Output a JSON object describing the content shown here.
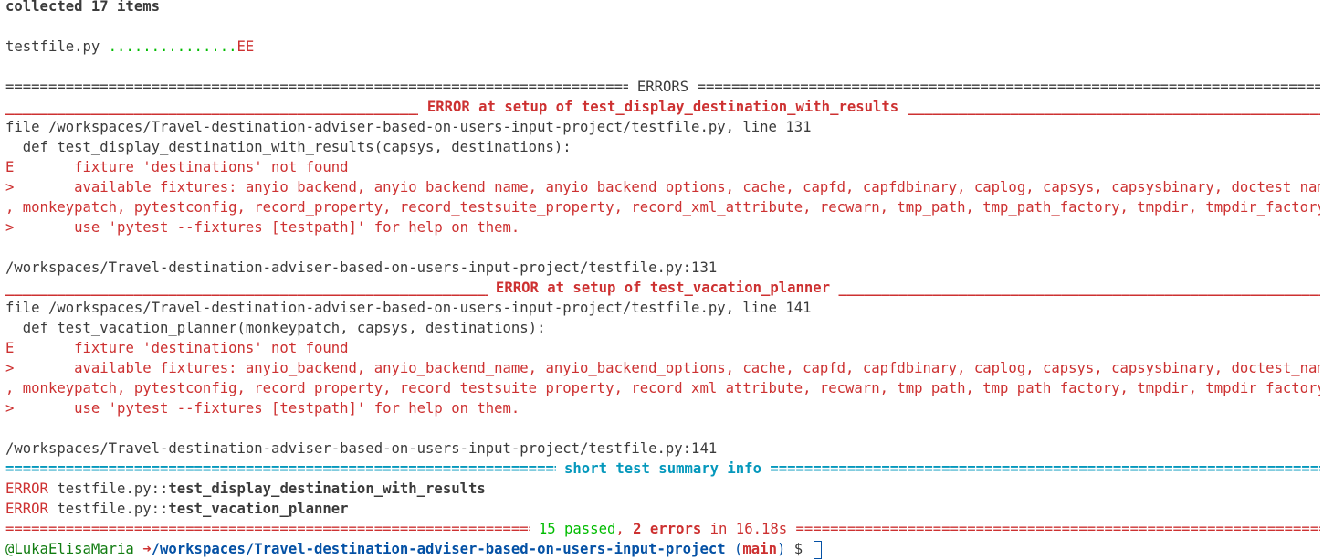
{
  "colors": {
    "background": "#ffffff",
    "text": "#3b3b3b",
    "error_red": "#cd3131",
    "pass_green": "#00bc00",
    "summary_cyan": "#0598bc",
    "prompt_blue": "#0451a5"
  },
  "header": {
    "collected": "collected 17 items"
  },
  "progress": {
    "file": "testfile.py ",
    "dots": "...............",
    "errs": "EE"
  },
  "errors_header": " ERRORS ",
  "errors": [
    {
      "title": " ERROR at setup of test_display_destination_with_results ",
      "file_line": "file /workspaces/Travel-destination-adviser-based-on-users-input-project/testfile.py, line 131",
      "def_line": "  def test_display_destination_with_results(capsys, destinations):",
      "e_prefix": "E       ",
      "e_text": "fixture 'destinations' not found",
      "avail_prefix": ">       ",
      "avail_text": "available fixtures: anyio_backend, anyio_backend_name, anyio_backend_options, cache, capfd, capfdbinary, caplog, capsys, capsysbinary, doctest_namespace",
      "avail_cont": ", monkeypatch, pytestconfig, record_property, record_testsuite_property, record_xml_attribute, recwarn, tmp_path, tmp_path_factory, tmpdir, tmpdir_factory",
      "use_prefix": ">       ",
      "use_text": "use 'pytest --fixtures [testpath]' for help on them.",
      "location": "/workspaces/Travel-destination-adviser-based-on-users-input-project/testfile.py:131"
    },
    {
      "title": " ERROR at setup of test_vacation_planner ",
      "file_line": "file /workspaces/Travel-destination-adviser-based-on-users-input-project/testfile.py, line 141",
      "def_line": "  def test_vacation_planner(monkeypatch, capsys, destinations):",
      "e_prefix": "E       ",
      "e_text": "fixture 'destinations' not found",
      "avail_prefix": ">       ",
      "avail_text": "available fixtures: anyio_backend, anyio_backend_name, anyio_backend_options, cache, capfd, capfdbinary, caplog, capsys, capsysbinary, doctest_namespace",
      "avail_cont": ", monkeypatch, pytestconfig, record_property, record_testsuite_property, record_xml_attribute, recwarn, tmp_path, tmp_path_factory, tmpdir, tmpdir_factory",
      "use_prefix": ">       ",
      "use_text": "use 'pytest --fixtures [testpath]' for help on them.",
      "location": "/workspaces/Travel-destination-adviser-based-on-users-input-project/testfile.py:141"
    }
  ],
  "summary": {
    "title": " short test summary info ",
    "items": [
      {
        "kind": "ERROR",
        "file": " testfile.py::",
        "test": "test_display_destination_with_results"
      },
      {
        "kind": "ERROR",
        "file": " testfile.py::",
        "test": "test_vacation_planner"
      }
    ]
  },
  "result": {
    "passed": " 15 passed",
    "comma": ", ",
    "errors": "2 errors",
    "time": " in 16.18s "
  },
  "prompt": {
    "user": "@LukaElisaMaria ",
    "arrow": "➜",
    "path": "/workspaces/Travel-destination-adviser-based-on-users-input-project",
    "branch_open": " (",
    "branch": "main",
    "branch_close": ")",
    "symbol": " $ "
  }
}
